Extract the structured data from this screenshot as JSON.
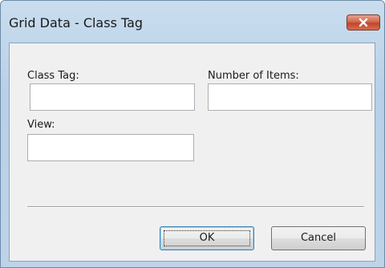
{
  "window": {
    "title": "Grid Data - Class Tag"
  },
  "form": {
    "class_tag": {
      "label": "Class Tag:",
      "value": ""
    },
    "number_of_items": {
      "label": "Number of Items:",
      "value": ""
    },
    "view": {
      "label": "View:",
      "value": ""
    }
  },
  "buttons": {
    "ok_label": "OK",
    "cancel_label": "Cancel"
  },
  "icons": {
    "close": "close-icon"
  },
  "colors": {
    "titlebar": "#bcd3e8",
    "close_button": "#c9533a",
    "client_bg": "#f0f0f0",
    "default_button_border": "#3c7fb1"
  }
}
